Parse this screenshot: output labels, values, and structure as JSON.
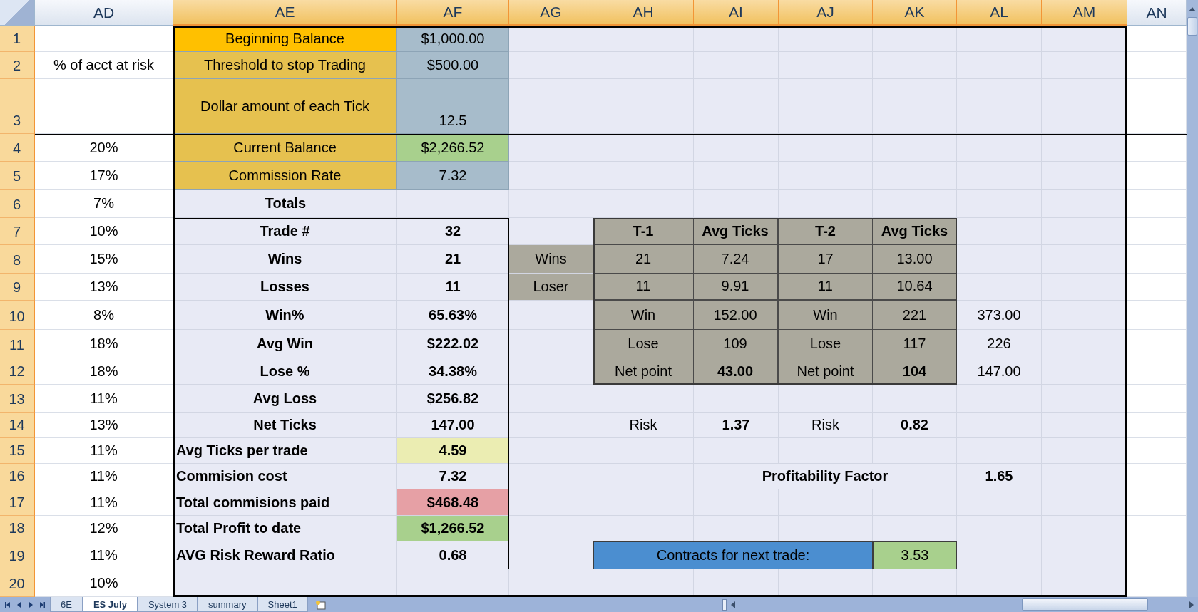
{
  "columns": [
    {
      "label": "AD",
      "selected": false
    },
    {
      "label": "AE",
      "selected": true
    },
    {
      "label": "AF",
      "selected": true
    },
    {
      "label": "AG",
      "selected": true
    },
    {
      "label": "AH",
      "selected": true
    },
    {
      "label": "AI",
      "selected": true
    },
    {
      "label": "AJ",
      "selected": true
    },
    {
      "label": "AK",
      "selected": true
    },
    {
      "label": "AL",
      "selected": true
    },
    {
      "label": "AM",
      "selected": true
    },
    {
      "label": "AN",
      "selected": false
    }
  ],
  "rows": [
    {
      "label": "1",
      "selected": true,
      "cells": {
        "ae": "Beginning Balance",
        "af": "$1,000.00"
      }
    },
    {
      "label": "2",
      "selected": true,
      "cells": {
        "ad": "% of acct at risk",
        "ae": "Threshold to stop Trading",
        "af": "$500.00"
      }
    },
    {
      "label": "3",
      "selected": true,
      "cells": {
        "ae": "Dollar amount of each Tick",
        "af": "12.5"
      }
    },
    {
      "label": "4",
      "selected": true,
      "cells": {
        "ad": "20%",
        "ae": "Current Balance",
        "af": "$2,266.52"
      }
    },
    {
      "label": "5",
      "selected": true,
      "cells": {
        "ad": "17%",
        "ae": "Commission Rate",
        "af": "7.32"
      }
    },
    {
      "label": "6",
      "selected": true,
      "cells": {
        "ad": "7%",
        "ae": "Totals"
      }
    },
    {
      "label": "7",
      "selected": true,
      "cells": {
        "ad": "10%",
        "ae": "Trade #",
        "af": "32",
        "ah": "T-1",
        "ai": "Avg Ticks",
        "aj": "T-2",
        "ak": "Avg Ticks"
      }
    },
    {
      "label": "8",
      "selected": true,
      "cells": {
        "ad": "15%",
        "ae": "Wins",
        "af": "21",
        "ag": "Wins",
        "ah": "21",
        "ai": "7.24",
        "aj": "17",
        "ak": "13.00"
      }
    },
    {
      "label": "9",
      "selected": true,
      "cells": {
        "ad": "13%",
        "ae": "Losses",
        "af": "11",
        "ag": "Loser",
        "ah": "11",
        "ai": "9.91",
        "aj": "11",
        "ak": "10.64"
      }
    },
    {
      "label": "10",
      "selected": true,
      "cells": {
        "ad": "8%",
        "ae": "Win%",
        "af": "65.63%",
        "ah": "Win",
        "ai": "152.00",
        "aj": "Win",
        "ak": "221",
        "al": "373.00"
      }
    },
    {
      "label": "11",
      "selected": true,
      "cells": {
        "ad": "18%",
        "ae": "Avg Win",
        "af": "$222.02",
        "ah": "Lose",
        "ai": "109",
        "aj": "Lose",
        "ak": "117",
        "al": "226"
      }
    },
    {
      "label": "12",
      "selected": true,
      "cells": {
        "ad": "18%",
        "ae": "Lose %",
        "af": "34.38%",
        "ah": "Net point",
        "ai": "43.00",
        "aj": "Net point",
        "ak": "104",
        "al": "147.00"
      }
    },
    {
      "label": "13",
      "selected": true,
      "cells": {
        "ad": "11%",
        "ae": "Avg Loss",
        "af": "$256.82"
      }
    },
    {
      "label": "14",
      "selected": true,
      "cells": {
        "ad": "13%",
        "ae": "Net Ticks",
        "af": "147.00",
        "ah": "Risk",
        "ai": "1.37",
        "aj": "Risk",
        "ak": "0.82"
      }
    },
    {
      "label": "15",
      "selected": true,
      "cells": {
        "ad": "11%",
        "ae": "Avg Ticks per trade",
        "af": "4.59"
      }
    },
    {
      "label": "16",
      "selected": true,
      "cells": {
        "ad": "11%",
        "ae": "Commision cost",
        "af": "7.32",
        "ai": "Profitability Factor",
        "al": "1.65"
      }
    },
    {
      "label": "17",
      "selected": true,
      "cells": {
        "ad": "11%",
        "ae": "Total commisions paid",
        "af": "$468.48"
      }
    },
    {
      "label": "18",
      "selected": true,
      "cells": {
        "ad": "12%",
        "ae": "Total Profit to date",
        "af": "$1,266.52"
      }
    },
    {
      "label": "19",
      "selected": true,
      "cells": {
        "ad": "11%",
        "ae": "AVG Risk Reward Ratio",
        "af": "0.68",
        "ah": "Contracts for next trade:",
        "ak": "3.53"
      }
    },
    {
      "label": "20",
      "selected": true,
      "cells": {
        "ad": "10%"
      }
    }
  ],
  "sheet_tabs": [
    {
      "label": "6E",
      "selected": false
    },
    {
      "label": "ES July",
      "selected": true
    },
    {
      "label": "System 3",
      "selected": false
    },
    {
      "label": "summary",
      "selected": false
    },
    {
      "label": "Sheet1",
      "selected": false
    }
  ]
}
